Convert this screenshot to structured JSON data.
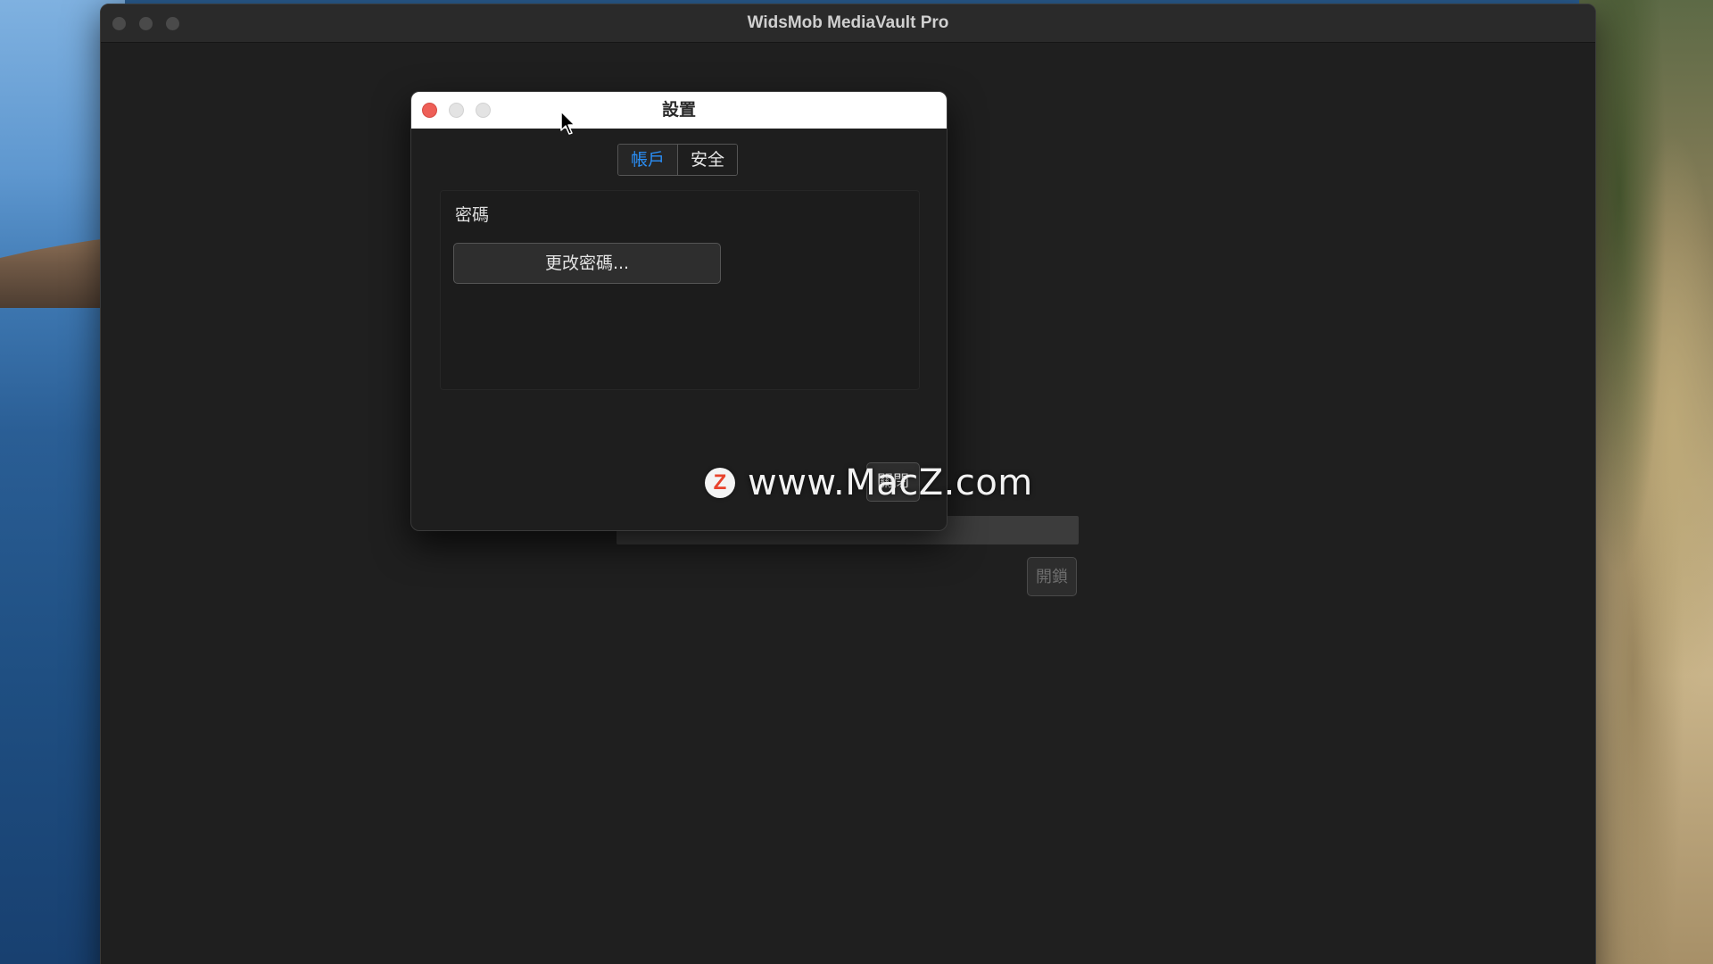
{
  "main_window": {
    "title": "WidsMob MediaVault Pro",
    "unlock_label": "開鎖"
  },
  "settings_dialog": {
    "title": "設置",
    "tabs": [
      {
        "label": "帳戶",
        "active": true
      },
      {
        "label": "安全",
        "active": false
      }
    ],
    "password_section_label": "密碼",
    "change_password_label": "更改密碼...",
    "close_label": "關閉"
  },
  "watermark": {
    "logo_letter": "Z",
    "text": "www.MacZ.com"
  },
  "colors": {
    "window_bg": "#1f1f1f",
    "active_tab_text": "#2a8ff7",
    "close_traffic": "#ee5f57",
    "watermark_logo": "#e8432d"
  },
  "icons": {
    "cursor": "arrow-pointer-icon",
    "dialog_close": "close-dot-icon",
    "dialog_minimize": "minimize-dot-icon",
    "dialog_zoom": "zoom-dot-icon"
  }
}
